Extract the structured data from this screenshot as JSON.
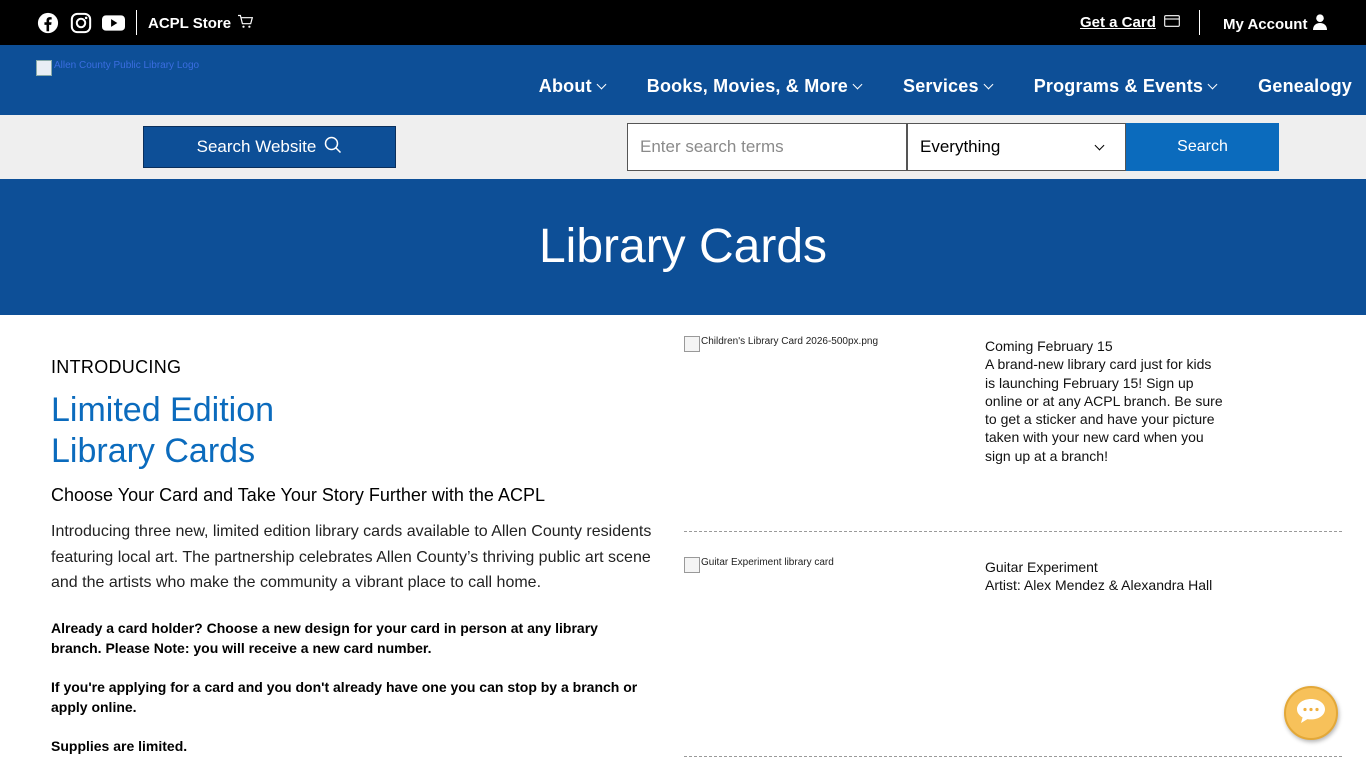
{
  "topbar": {
    "social": [
      "facebook-icon",
      "instagram-icon",
      "youtube-icon"
    ],
    "store_label": "ACPL Store",
    "get_card_label": "Get a Card",
    "account_label": "My Account"
  },
  "navbar": {
    "logo_alt": "Allen County Public Library Logo",
    "menu": [
      {
        "label": "About",
        "has_dropdown": true
      },
      {
        "label": "Books, Movies, & More",
        "has_dropdown": true
      },
      {
        "label": "Services",
        "has_dropdown": true
      },
      {
        "label": "Programs & Events",
        "has_dropdown": true
      },
      {
        "label": "Genealogy",
        "has_dropdown": false
      }
    ]
  },
  "search": {
    "website_button": "Search Website",
    "placeholder": "Enter search terms",
    "scope_selected": "Everything",
    "submit_label": "Search"
  },
  "hero": {
    "title": "Library Cards"
  },
  "main": {
    "intro": "INTRODUCING",
    "headline_line1": "Limited Edition",
    "headline_line2": "Library Cards",
    "subhead": "Choose Your Card and Take Your Story Further with the ACPL",
    "body": "Introducing three new, limited edition library cards available to Allen County residents featuring local art. The partnership celebrates Allen County’s thriving public art scene and the artists who make the community a vibrant place to call home.",
    "note1": "Already a card holder? Choose a new design for your card in person at any library branch.  Please Note: you will receive a new card number.",
    "note2": "If you're applying for a card and you don't already have one you can stop by a branch or apply online.",
    "note3": "Supplies are limited."
  },
  "cards": [
    {
      "image_alt": "Children's Library Card 2026-500px.png",
      "title": "Coming February 15",
      "description": "A brand-new library card just for kids is launching February 15! Sign up online or at any ACPL branch. Be sure to get a sticker and have your picture taken with your new card when you sign up at a branch!"
    },
    {
      "image_alt": "Guitar Experiment library card",
      "title": "Guitar Experiment",
      "description": "Artist: Alex Mendez & Alexandra Hall"
    }
  ],
  "colors": {
    "brand_blue": "#0d4f97",
    "link_blue": "#0b6bbd",
    "chat_yellow": "#f7c15a"
  }
}
